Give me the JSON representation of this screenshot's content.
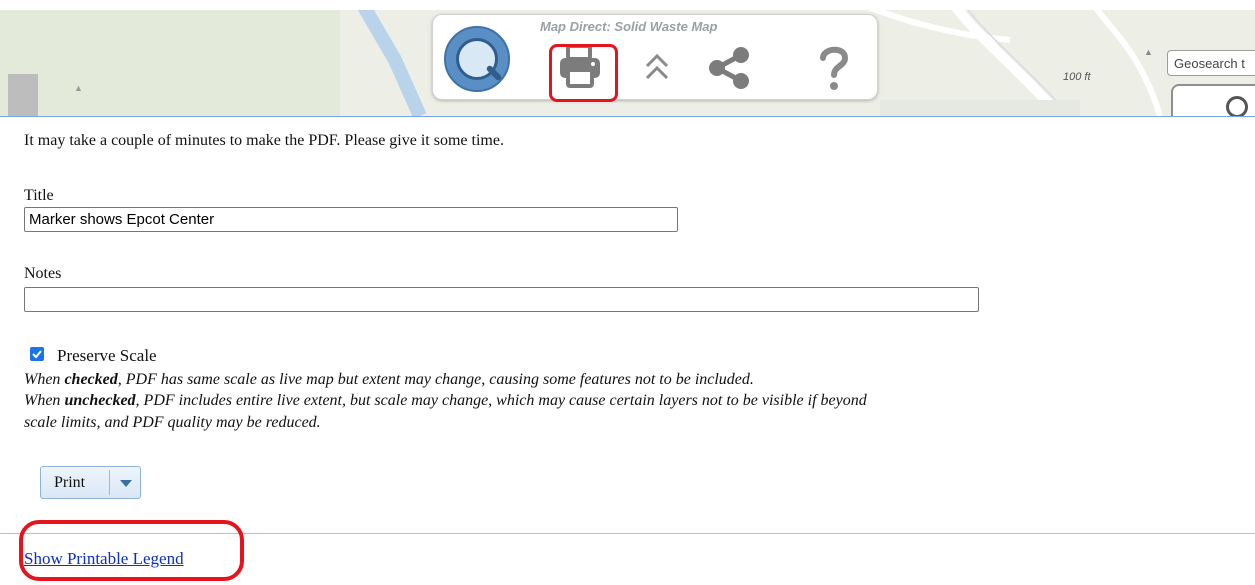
{
  "toolbar": {
    "title": "Map Direct: Solid Waste Map",
    "icons": [
      "map-direct-logo-icon",
      "print-icon",
      "double-chevron-up-icon",
      "share-icon",
      "help-icon"
    ]
  },
  "map": {
    "scale_label": "100 ft",
    "geosearch_placeholder": "Geosearch t"
  },
  "print_panel": {
    "intro": "It may take a couple of minutes to make the PDF. Please give it some time.",
    "title_label": "Title",
    "title_value": "Marker shows Epcot Center",
    "notes_label": "Notes",
    "notes_value": "",
    "preserve_scale_label": "Preserve Scale",
    "preserve_scale_checked": true,
    "checked_prefix": "When ",
    "checked_word": "checked",
    "checked_text": ", PDF has same scale as live map but extent may change, causing some features not to be included.",
    "unchecked_prefix": "When ",
    "unchecked_word": "unchecked",
    "unchecked_text_1": ", PDF includes entire live extent, but scale may change, which may cause certain layers not to be visible if beyond",
    "unchecked_text_2": "scale limits, and PDF quality may be reduced.",
    "print_button": "Print",
    "legend_link": "Show Printable Legend"
  },
  "colors": {
    "highlight": "#e5141c",
    "link": "#0b2fc9",
    "checkbox": "#1a73e8"
  }
}
